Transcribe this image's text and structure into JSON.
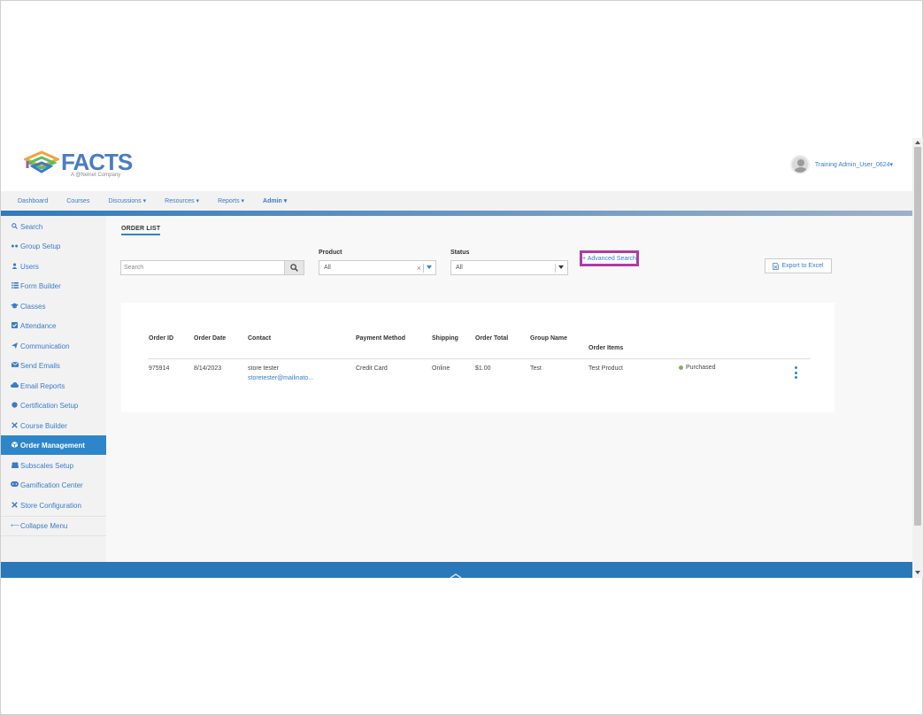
{
  "header": {
    "logo_text": "FACTS",
    "logo_subtext": "A @Nelnet Company",
    "user_name": "Training Admin_User_0624",
    "user_caret": "▾"
  },
  "nav": {
    "items": [
      {
        "label": "Dashboard"
      },
      {
        "label": "Courses"
      },
      {
        "label": "Discussions ▾"
      },
      {
        "label": "Resources ▾"
      },
      {
        "label": "Reports ▾"
      },
      {
        "label": "Admin ▾"
      }
    ]
  },
  "sidebar": {
    "items": [
      {
        "label": "Search",
        "icon": "search-icon"
      },
      {
        "label": "Group Setup",
        "icon": "group-icon"
      },
      {
        "label": "Users",
        "icon": "user-icon"
      },
      {
        "label": "Form Builder",
        "icon": "list-icon"
      },
      {
        "label": "Classes",
        "icon": "graduation-cap-icon"
      },
      {
        "label": "Attendance",
        "icon": "checkbox-icon"
      },
      {
        "label": "Communication",
        "icon": "paper-plane-icon"
      },
      {
        "label": "Send Emails",
        "icon": "envelope-icon"
      },
      {
        "label": "Email Reports",
        "icon": "cloud-icon"
      },
      {
        "label": "Certification Setup",
        "icon": "certificate-icon"
      },
      {
        "label": "Course Builder",
        "icon": "tools-icon"
      },
      {
        "label": "Order Management",
        "icon": "cube-icon",
        "active": true
      },
      {
        "label": "Subscales Setup",
        "icon": "subscales-icon"
      },
      {
        "label": "Gamification Center",
        "icon": "gamepad-icon"
      },
      {
        "label": "Store Configuration",
        "icon": "wrench-icon"
      },
      {
        "label": "Collapse Menu",
        "icon": "arrow-left-icon"
      }
    ]
  },
  "main": {
    "tab_title": "ORDER LIST",
    "search": {
      "placeholder": "Search",
      "value": ""
    },
    "product": {
      "label": "Product",
      "value": "All"
    },
    "status": {
      "label": "Status",
      "value": "All"
    },
    "advanced_search_label": "+ Advanced Search",
    "export_label": "Export to Excel",
    "table": {
      "headers": {
        "order_id": "Order ID",
        "order_date": "Order Date",
        "contact": "Contact",
        "payment_method": "Payment Method",
        "shipping": "Shipping",
        "order_total": "Order Total",
        "group_name": "Group Name",
        "order_items": "Order Items"
      },
      "rows": [
        {
          "order_id": "975914",
          "order_date": "8/14/2023",
          "contact_name": "store tester",
          "contact_email": "storetester@mailinato...",
          "payment_method": "Credit Card",
          "shipping": "Online",
          "order_total": "$1.00",
          "group_name": "Test",
          "order_items": "Test Product",
          "status": "Purchased"
        }
      ]
    }
  },
  "colors": {
    "accent": "#2d86c9",
    "highlight_border": "#b03aa5",
    "status_purchased": "#7bb661",
    "footer": "#2a78b8"
  }
}
